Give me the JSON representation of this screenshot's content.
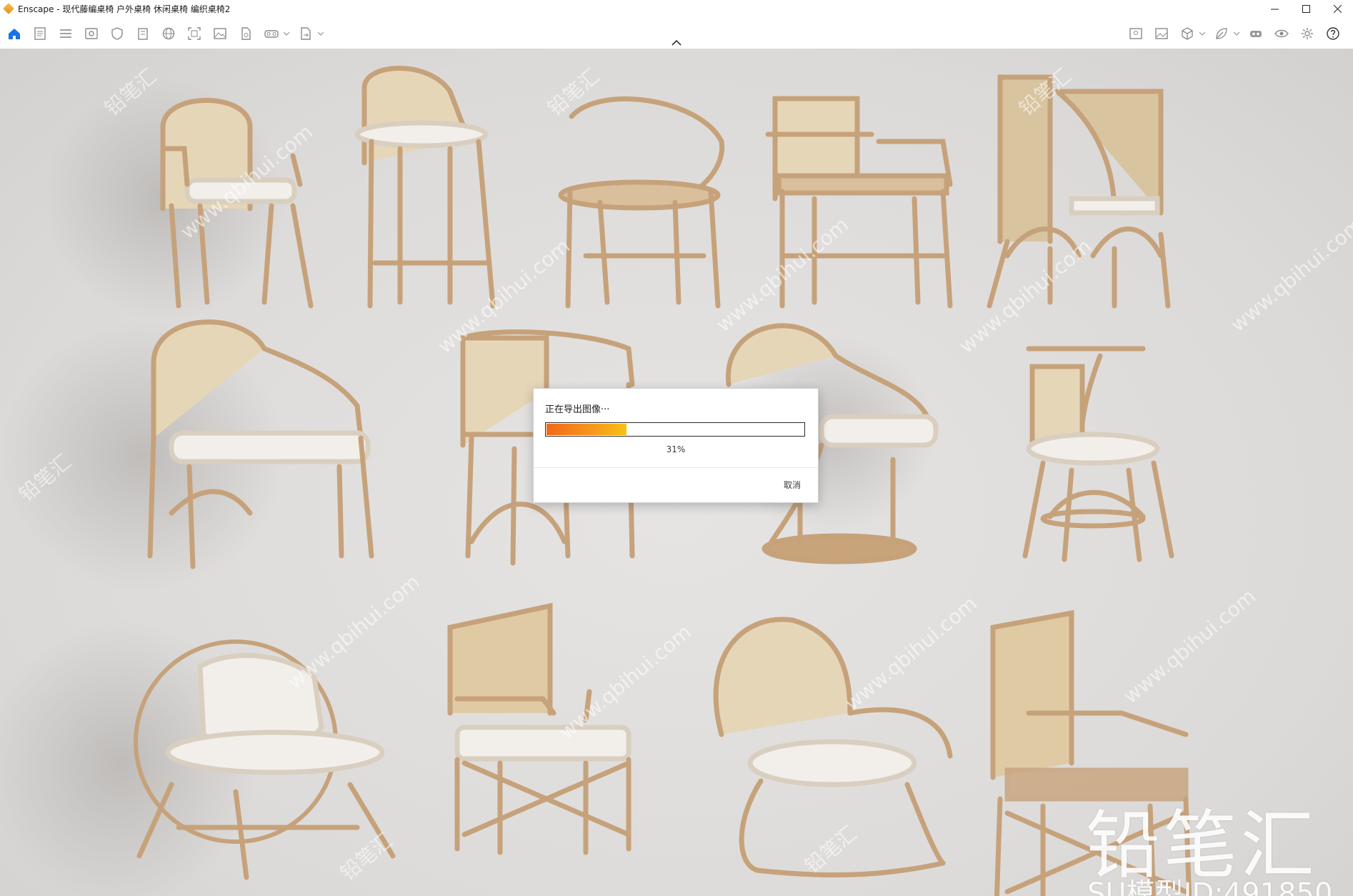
{
  "window": {
    "title": "Enscape - 现代藤编桌椅 户外桌椅 休闲桌椅 编织桌椅2",
    "controls": [
      "minimize-icon",
      "maximize-icon",
      "close-icon"
    ]
  },
  "toolbar": {
    "left_icons": [
      "home-icon",
      "document-icon",
      "list-icon",
      "view-icon",
      "shield-icon",
      "building-icon",
      "globe-icon",
      "capture-icon",
      "image-icon",
      "file-icon",
      "vr-headset-icon",
      "export-icon"
    ],
    "right_icons": [
      "map-icon",
      "gallery-icon",
      "cube-icon",
      "leaf-icon",
      "vr-icon",
      "eye-icon",
      "gear-icon",
      "help-icon"
    ]
  },
  "viewport": {
    "watermark_text": "www.qbihui.com",
    "watermark_cn": "铅笔汇",
    "brand_mark": "铅笔汇",
    "model_id": "SU模型ID:491850"
  },
  "dialog": {
    "title": "正在导出图像···",
    "progress": 0.31,
    "progress_label": "31%",
    "cancel_label": "取消"
  },
  "colors": {
    "progress_start": "#f06a18",
    "progress_end": "#f7c114",
    "accent_blue": "#1a73e8",
    "rattan": "#c9a47a",
    "cushion": "#f2efea"
  }
}
